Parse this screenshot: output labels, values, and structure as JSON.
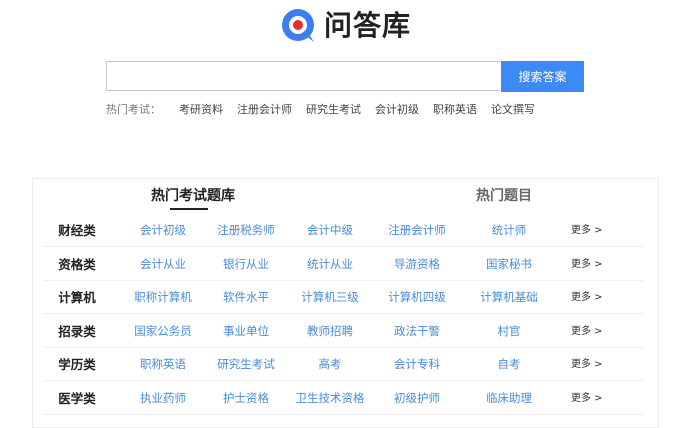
{
  "logo": {
    "text": "问答库",
    "colors": {
      "primary": "#3b7ef0",
      "accent": "#e2302c"
    }
  },
  "search": {
    "placeholder": "",
    "value": "",
    "button_label": "搜索答案"
  },
  "hot_exams": {
    "label": "热门考试：",
    "links": [
      "考研资料",
      "注册会计师",
      "研究生考试",
      "会计初级",
      "职称英语",
      "论文撰写"
    ]
  },
  "tabs": [
    "热门考试题库",
    "热门题目"
  ],
  "more_label": "更多 >",
  "categories": [
    {
      "name": "财经类",
      "items": [
        "会计初级",
        "注册税务师",
        "会计中级",
        "注册会计师",
        "统计师"
      ]
    },
    {
      "name": "资格类",
      "items": [
        "会计从业",
        "银行从业",
        "统计从业",
        "导游资格",
        "国家秘书"
      ]
    },
    {
      "name": "计算机",
      "items": [
        "职称计算机",
        "软件水平",
        "计算机三级",
        "计算机四级",
        "计算机基础"
      ]
    },
    {
      "name": "招录类",
      "items": [
        "国家公务员",
        "事业单位",
        "教师招聘",
        "政法干警",
        "村官"
      ]
    },
    {
      "name": "学历类",
      "items": [
        "职称英语",
        "研究生考试",
        "高考",
        "会计专科",
        "自考"
      ]
    },
    {
      "name": "医学类",
      "items": [
        "执业药师",
        "护士资格",
        "卫生技术资格",
        "初级护师",
        "临床助理"
      ]
    }
  ]
}
